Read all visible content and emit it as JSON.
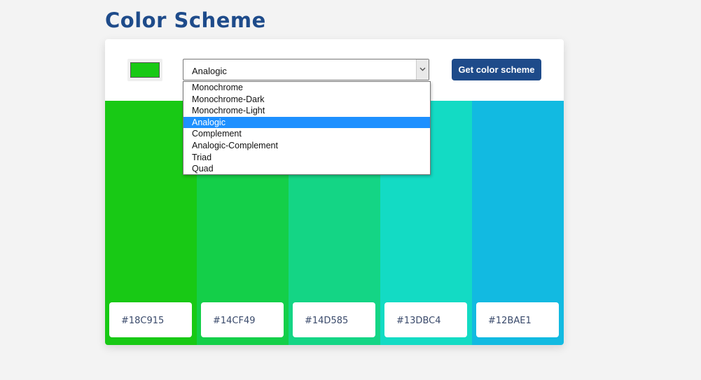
{
  "page": {
    "title": "Color Scheme"
  },
  "controls": {
    "seed_color": "#18c915",
    "mode_selected": "Analogic",
    "button_label": "Get color scheme"
  },
  "dropdown": {
    "options": [
      "Monochrome",
      "Monochrome-Dark",
      "Monochrome-Light",
      "Analogic",
      "Complement",
      "Analogic-Complement",
      "Triad",
      "Quad"
    ],
    "highlighted_index": 3
  },
  "colors": [
    {
      "hex": "#18C915"
    },
    {
      "hex": "#14CF49"
    },
    {
      "hex": "#14D585"
    },
    {
      "hex": "#13DBC4"
    },
    {
      "hex": "#12BAE1"
    }
  ],
  "theme": {
    "accent": "#1e4b8a",
    "highlight": "#1e90ff"
  }
}
